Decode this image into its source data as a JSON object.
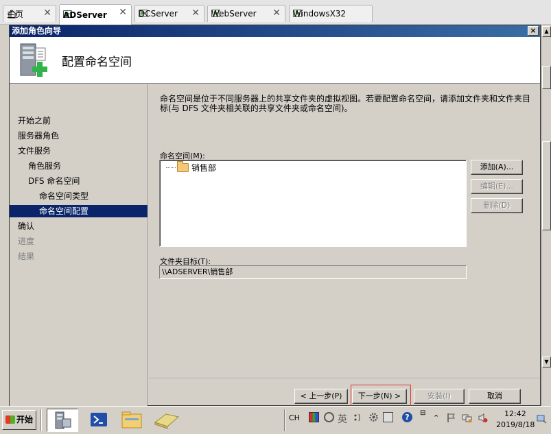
{
  "vm_tabs": [
    {
      "label": "主页",
      "icon": "home-icon",
      "active": false
    },
    {
      "label": "ADServer",
      "icon": "vm-icon",
      "active": true
    },
    {
      "label": "DCServer",
      "icon": "vm-icon",
      "active": false
    },
    {
      "label": "WebServer",
      "icon": "vm-icon",
      "active": false
    },
    {
      "label": "WindowsX32",
      "icon": "vm-icon",
      "active": false
    }
  ],
  "close_glyph": "✕",
  "dialog": {
    "title": "添加角色向导",
    "close_glyph": "×",
    "header_title": "配置命名空间"
  },
  "steps": [
    {
      "label": "开始之前",
      "state": "normal"
    },
    {
      "label": "服务器角色",
      "state": "normal"
    },
    {
      "label": "文件服务",
      "state": "normal"
    },
    {
      "label": "角色服务",
      "state": "normal"
    },
    {
      "label": "DFS 命名空间",
      "state": "normal"
    },
    {
      "label": "命名空间类型",
      "state": "normal"
    },
    {
      "label": "命名空间配置",
      "state": "selected"
    },
    {
      "label": "确认",
      "state": "normal"
    },
    {
      "label": "进度",
      "state": "disabled"
    },
    {
      "label": "结果",
      "state": "disabled"
    }
  ],
  "content": {
    "description": "命名空间是位于不同服务器上的共享文件夹的虚拟视图。若要配置命名空间，请添加文件夹和文件夹目标(与 DFS 文件夹相关联的共享文件夹或命名空间)。",
    "namespace_label": "命名空间(M):",
    "tree_item": "销售部",
    "add_button": "添加(A)...",
    "edit_button": "编辑(E)...",
    "delete_button": "删除(D)",
    "target_label": "文件夹目标(T):",
    "target_value": "\\\\ADSERVER\\销售部"
  },
  "nav": {
    "back": "< 上一步(P)",
    "next": "下一步(N) >",
    "install": "安装(I)",
    "cancel": "取消"
  },
  "taskbar": {
    "start": "开始",
    "lang": "CH",
    "ime": "英",
    "time": "12:42",
    "date": "2019/8/18"
  },
  "colors": {
    "title_gradient_start": "#0a246a",
    "selection": "#0a246a",
    "highlight_box": "#e03030"
  }
}
